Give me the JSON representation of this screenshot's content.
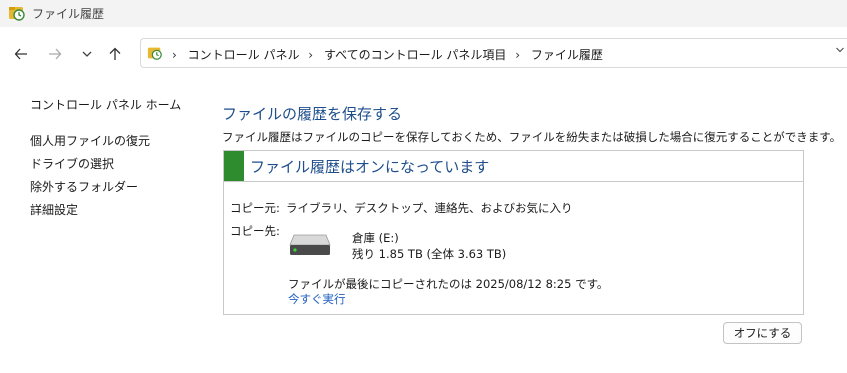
{
  "window": {
    "title": "ファイル履歴",
    "icon": "file-history-icon"
  },
  "nav": {
    "back_icon": "back-arrow-icon",
    "forward_icon": "forward-arrow-icon",
    "recent_icon": "chevron-down-icon",
    "up_icon": "up-arrow-icon",
    "breadcrumb": [
      "コントロール パネル",
      "すべてのコントロール パネル項目",
      "ファイル履歴"
    ]
  },
  "sidebar": {
    "home": "コントロール パネル ホーム",
    "items": [
      "個人用ファイルの復元",
      "ドライブの選択",
      "除外するフォルダー",
      "詳細設定"
    ]
  },
  "main": {
    "heading": "ファイルの履歴を保存する",
    "description": "ファイル履歴はファイルのコピーを保存しておくため、ファイルを紛失または破損した場合に復元することができます。",
    "status_title": "ファイル履歴はオンになっています",
    "status_color": "#2e8b2e",
    "copy_from_label": "コピー元:",
    "copy_from_value": "ライブラリ、デスクトップ、連絡先、およびお気に入り",
    "copy_to_label": "コピー先:",
    "drive_name": "倉庫 (E:)",
    "drive_space": "残り 1.85 TB (全体 3.63 TB)",
    "last_copy": "ファイルが最後にコピーされたのは 2025/08/12 8:25 です。",
    "run_now": "今すぐ実行"
  },
  "actions": {
    "turn_off": "オフにする"
  }
}
